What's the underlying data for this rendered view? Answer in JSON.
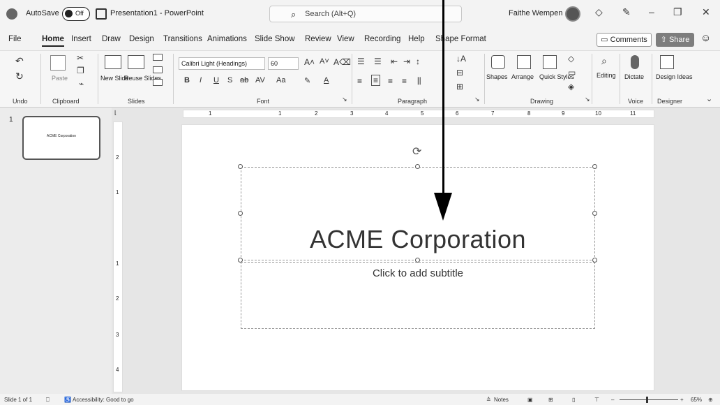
{
  "titlebar": {
    "autosave_label": "AutoSave",
    "autosave_state": "Off",
    "doc_title": "Presentation1 - PowerPoint",
    "search_placeholder": "Search (Alt+Q)",
    "user_name": "Faithe Wempen"
  },
  "menu": {
    "items": [
      "File",
      "Home",
      "Insert",
      "Draw",
      "Design",
      "Transitions",
      "Animations",
      "Slide Show",
      "Review",
      "View",
      "Recording",
      "Help",
      "Shape Format"
    ],
    "active": "Home",
    "comments_label": "Comments",
    "share_label": "Share"
  },
  "ribbon": {
    "groups": [
      "Undo",
      "Clipboard",
      "Slides",
      "Font",
      "Paragraph",
      "Drawing",
      "Voice",
      "Designer"
    ],
    "paste_label": "Paste",
    "new_slide_label": "New Slide",
    "reuse_slides_label": "Reuse Slides",
    "font_name": "Calibri Light (Headings)",
    "font_size": "60",
    "shapes_label": "Shapes",
    "arrange_label": "Arrange",
    "quick_styles_label": "Quick Styles",
    "editing_label": "Editing",
    "dictate_label": "Dictate",
    "design_ideas_label": "Design Ideas"
  },
  "thumbnails": [
    {
      "number": "1",
      "title": "ACME Corporation"
    }
  ],
  "ruler": {
    "top": [
      "1",
      "1",
      "2",
      "3",
      "4",
      "5",
      "6",
      "7",
      "8",
      "9",
      "10",
      "11"
    ],
    "left": [
      "2",
      "1",
      "1",
      "2",
      "3",
      "4"
    ]
  },
  "slide": {
    "title": "ACME Corporation",
    "subtitle_placeholder": "Click to add subtitle"
  },
  "status": {
    "slide_info": "Slide 1 of 1",
    "accessibility": "Accessibility: Good to go",
    "notes_label": "Notes",
    "zoom": "65%"
  },
  "colors": {
    "accent": "#222222",
    "share_bg": "#7d7d7d"
  }
}
